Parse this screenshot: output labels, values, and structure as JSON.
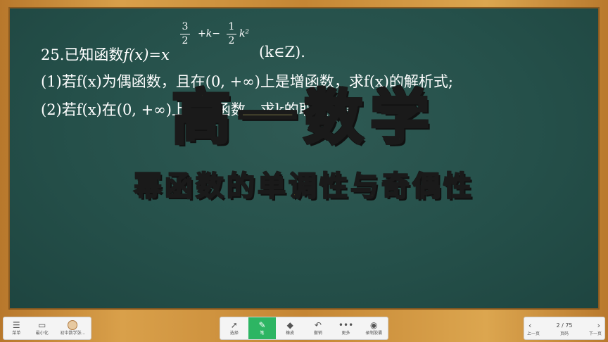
{
  "problem": {
    "title_prefix": "25.已知函数",
    "title_func": "f(x)",
    "title_eq": "=x",
    "exp_num1": "3",
    "exp_den1": "2",
    "exp_mid": "+k−",
    "exp_num2": "1",
    "exp_den2": "2",
    "exp_tail": "k²",
    "title_suffix": "(k∈Z).",
    "q1": "(1)若f(x)为偶函数，且在(0, +∞)上是增函数，求f(x)的解析式;",
    "q2": "(2)若f(x)在(0, +∞)上是减函数，求k的取值范围"
  },
  "overlay": {
    "title": "高一数学",
    "subtitle": "幂函数的单调性与奇偶性"
  },
  "toolbar_left": [
    {
      "icon": "menu-icon",
      "glyph": "☰",
      "label": "菜单"
    },
    {
      "icon": "minimize-icon",
      "glyph": "▭",
      "label": "最小化"
    },
    {
      "icon": "avatar-icon",
      "glyph": "",
      "label": "初中数学张..."
    }
  ],
  "toolbar_mid": [
    {
      "icon": "cursor-icon",
      "glyph": "➚",
      "label": "选择"
    },
    {
      "icon": "pen-icon",
      "glyph": "✎",
      "label": "笔"
    },
    {
      "icon": "eraser-icon",
      "glyph": "◆",
      "label": "橡皮"
    },
    {
      "icon": "undo-icon",
      "glyph": "↶",
      "label": "撤销"
    },
    {
      "icon": "more-icon",
      "glyph": "•••",
      "label": "更多"
    },
    {
      "icon": "record-icon",
      "glyph": "◉",
      "label": "录制胶囊"
    }
  ],
  "pager": {
    "prev_label": "上一页",
    "page_label": "页码",
    "next_label": "下一页",
    "page": "2 / 75",
    "prev_glyph": "‹",
    "next_glyph": "›"
  },
  "colors": {
    "board": "#25504a",
    "title": "#fff27a",
    "subtitle": "#ffe24a",
    "active_tool": "#2db563"
  }
}
